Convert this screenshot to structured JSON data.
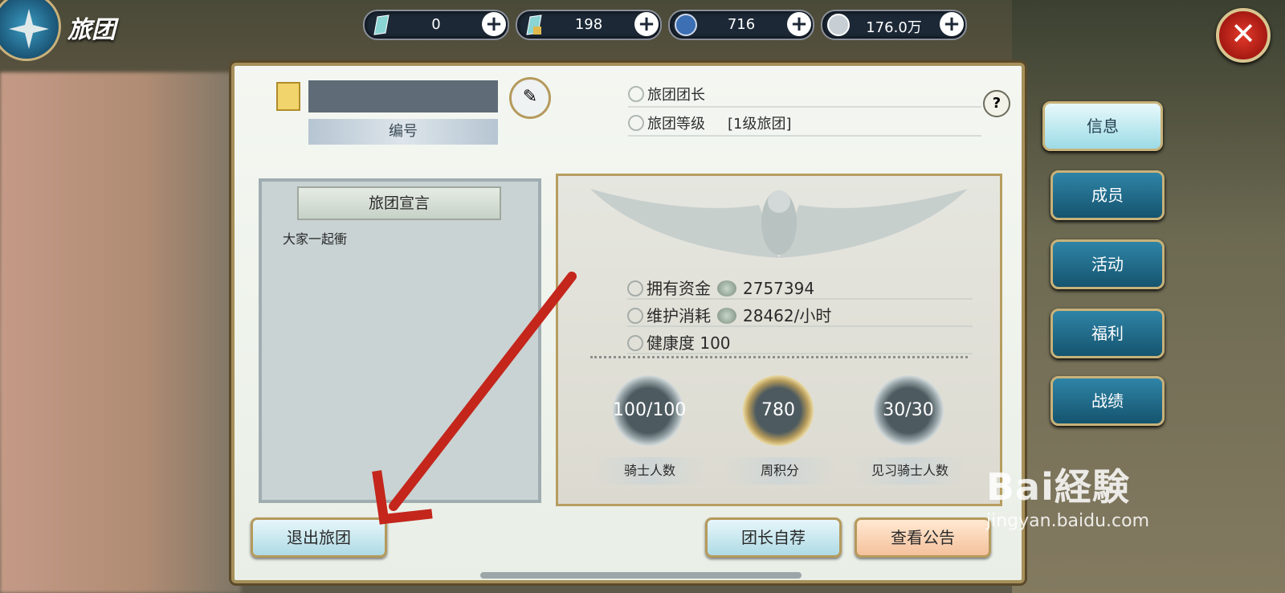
{
  "header": {
    "title": "旅团",
    "title_icon": "compass-emblem-icon"
  },
  "resources": [
    {
      "icon": "crystal-icon",
      "value": "0"
    },
    {
      "icon": "locked-crystal-icon",
      "value": "198"
    },
    {
      "icon": "contribution-icon",
      "value": "716"
    },
    {
      "icon": "silver-coin-icon",
      "value": "176.0万"
    }
  ],
  "guild": {
    "name": "",
    "id_label": "编号",
    "leader_label": "旅团团长",
    "leader_value": "",
    "level_label": "旅团等级",
    "level_value": "[1级旅团]"
  },
  "declaration": {
    "title": "旅团宣言",
    "text": "大家一起衝"
  },
  "stats": {
    "funds_label": "拥有资金",
    "funds_value": "2757394",
    "upkeep_label": "维护消耗",
    "upkeep_value": "28462/小时",
    "health_label": "健康度",
    "health_value": "100",
    "medals": [
      {
        "value": "100/100",
        "label": "骑士人数"
      },
      {
        "value": "780",
        "label": "周积分"
      },
      {
        "value": "30/30",
        "label": "见习骑士人数"
      }
    ]
  },
  "buttons": {
    "leave": "退出旅团",
    "self_recommend": "团长自荐",
    "view_notice": "查看公告"
  },
  "tabs": [
    {
      "label": "信息",
      "active": true
    },
    {
      "label": "成员",
      "active": false
    },
    {
      "label": "活动",
      "active": false
    },
    {
      "label": "福利",
      "active": false
    },
    {
      "label": "战绩",
      "active": false
    }
  ],
  "watermark": {
    "logo": "Bai経験",
    "url": "jingyan.baidu.com"
  },
  "colors": {
    "annotation_arrow": "#c4261c",
    "tab_active": "#9ddbe6",
    "tab_inactive": "#1f6b8c"
  }
}
